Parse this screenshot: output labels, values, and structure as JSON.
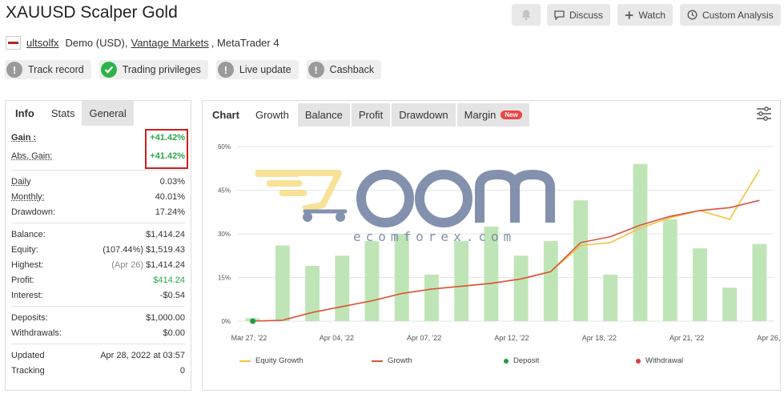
{
  "title": "XAUUSD Scalper Gold",
  "top_buttons": {
    "discuss": "Discuss",
    "watch": "Watch",
    "custom_analysis": "Custom Analysis"
  },
  "subline": {
    "user": "ultsolfx",
    "account": "Demo (USD),",
    "broker": "Vantage Markets",
    "platform": ", MetaTrader 4"
  },
  "badges": [
    {
      "label": "Track record",
      "status": "warn"
    },
    {
      "label": "Trading privileges",
      "status": "ok"
    },
    {
      "label": "Live update",
      "status": "warn"
    },
    {
      "label": "Cashback",
      "status": "warn"
    }
  ],
  "info": {
    "tabs": [
      "Info",
      "Stats",
      "General"
    ],
    "gain_label": "Gain :",
    "gain_value": "+41.42%",
    "abs_gain_label": "Abs. Gain:",
    "abs_gain_value": "+41.42%",
    "daily_label": "Daily",
    "daily_value": "0.03%",
    "monthly_label": "Monthly:",
    "monthly_value": "40.01%",
    "drawdown_label": "Drawdown:",
    "drawdown_value": "17.24%",
    "balance_label": "Balance:",
    "balance_value": "$1,414.24",
    "equity_label": "Equity:",
    "equity_note": "(107.44%)",
    "equity_value": "$1,519.43",
    "highest_label": "Highest:",
    "highest_note": "(Apr 26)",
    "highest_value": "$1,414.24",
    "profit_label": "Profit:",
    "profit_value": "$414.24",
    "interest_label": "Interest:",
    "interest_value": "-$0.54",
    "deposits_label": "Deposits:",
    "deposits_value": "$1,000.00",
    "withdrawals_label": "Withdrawals:",
    "withdrawals_value": "$0.00",
    "updated_label": "Updated",
    "updated_value": "Apr 28, 2022 at 03:57",
    "tracking_label": "Tracking",
    "tracking_value": "0"
  },
  "chart_tabs": [
    "Chart",
    "Growth",
    "Balance",
    "Profit",
    "Drawdown",
    "Margin"
  ],
  "chart_new_tag": "New",
  "watermark": {
    "brand": "ecomforex.com"
  },
  "colors": {
    "bar": "#bfe5b7",
    "equity_growth": "#f5c242",
    "growth": "#d9533d",
    "deposit": "#1e9e3e",
    "withdrawal": "#e03b3b",
    "gain_box": "#cc1f1f"
  },
  "chart_data": {
    "type": "bar",
    "ylim": [
      0,
      60
    ],
    "y_ticks": [
      "0%",
      "15%",
      "30%",
      "45%",
      "60%"
    ],
    "x_labels": [
      "Mar 27, '22",
      "Apr 04, '22",
      "Apr 07, '22",
      "Apr 12, '22",
      "Apr 18, '22",
      "Apr 21, '22",
      "Apr 26, '22"
    ],
    "bars": [
      1,
      26,
      19,
      22.5,
      27.5,
      30,
      16,
      27.5,
      32.5,
      22.5,
      27.5,
      41.5,
      16,
      54,
      35,
      25,
      11.5,
      26.5
    ],
    "series": [
      {
        "name": "Equity Growth",
        "values": [
          0,
          0.3,
          3,
          5,
          7,
          9.5,
          11,
          12,
          13,
          14.5,
          17,
          26,
          27,
          32,
          35.5,
          38,
          35,
          52
        ]
      },
      {
        "name": "Growth",
        "values": [
          0,
          0.3,
          3,
          5,
          7,
          9.5,
          11,
          12,
          13,
          14.5,
          17,
          27,
          29,
          33,
          36,
          38,
          39,
          41.5
        ]
      }
    ],
    "deposit_points": [
      {
        "index": 0,
        "value": 0
      }
    ],
    "legend": [
      "Equity Growth",
      "Growth",
      "Deposit",
      "Withdrawal"
    ],
    "legend_position": "bottom"
  }
}
